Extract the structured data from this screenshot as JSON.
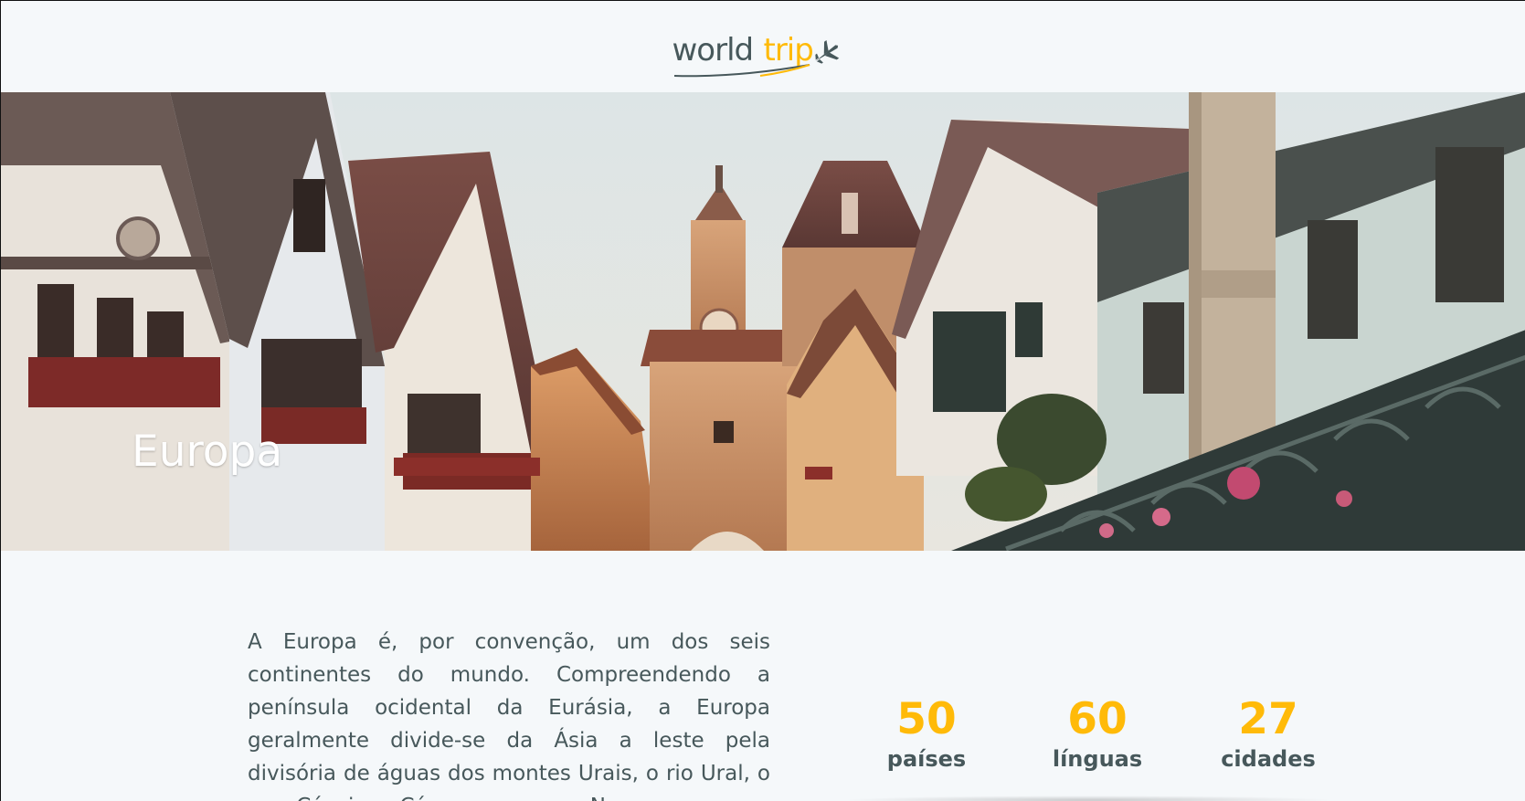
{
  "header": {
    "logo_world": "world",
    "logo_trip": "trip",
    "plane_icon": "airplane-icon"
  },
  "banner": {
    "title": "Europa"
  },
  "content": {
    "description": "A Europa é, por convenção, um dos seis continentes do mundo. Compreendendo a península ocidental da Eurásia, a Europa geralmente divide-se da Ásia a leste pela divisória de águas dos montes Urais, o rio Ural, o mar Cáspio, o Cáucaso, e o mar Negro a",
    "stats": [
      {
        "value": "50",
        "label": "países"
      },
      {
        "value": "60",
        "label": "línguas"
      },
      {
        "value": "27",
        "label": "cidades"
      }
    ]
  },
  "colors": {
    "accent": "#ffba08",
    "text": "#47585b",
    "background": "#f5f8fa"
  }
}
